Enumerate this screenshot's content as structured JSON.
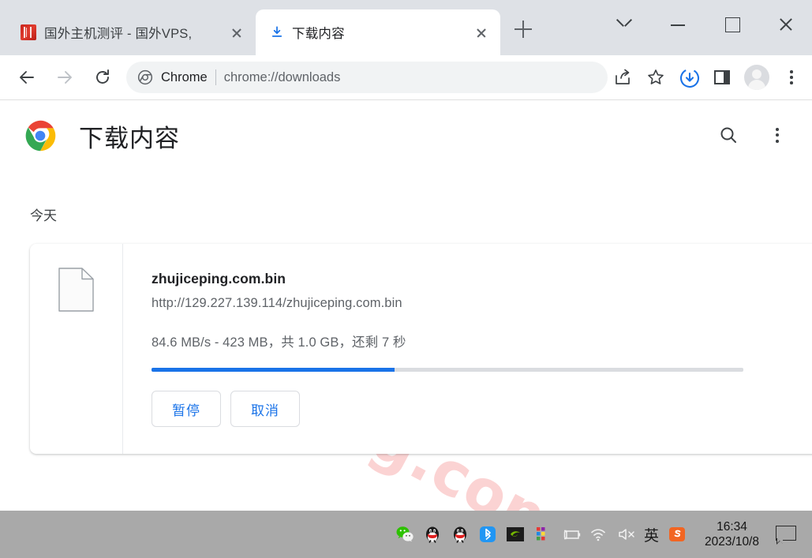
{
  "window": {
    "controls": {
      "tab_search": "tab-search",
      "minimize": "minimize",
      "maximize": "maximize",
      "close": "close"
    }
  },
  "tabs": [
    {
      "title": "国外主机测评 - 国外VPS,",
      "favicon": "seal-icon",
      "active": false
    },
    {
      "title": "下载内容",
      "favicon": "download-icon",
      "active": true
    }
  ],
  "new_tab_label": "+",
  "toolbar": {
    "back": "back-arrow",
    "forward": "forward-arrow",
    "reload": "reload",
    "omnibox": {
      "chrome_label": "Chrome",
      "url": "chrome://downloads"
    },
    "share": "share-icon",
    "bookmark": "star-icon",
    "downloads": "download-circle-icon",
    "side_panel": "side-panel-icon",
    "profile": "avatar",
    "menu": "three-dot-menu"
  },
  "page": {
    "title": "下载内容",
    "search_icon": "search-icon",
    "menu_icon": "three-dot-menu",
    "date_group": "今天",
    "watermark": "zhujiceping.com",
    "download": {
      "file_name": "zhujiceping.com.bin",
      "url": "http://129.227.139.114/zhujiceping.com.bin",
      "status": "84.6 MB/s - 423 MB，共 1.0 GB，还剩 7 秒",
      "progress_percent": 41,
      "pause_label": "暂停",
      "cancel_label": "取消"
    }
  },
  "taskbar": {
    "tray_icons": [
      "wechat-icon",
      "qq-icon",
      "qq-icon",
      "bluetooth-icon",
      "nvidia-icon",
      "windows-color-grid-icon",
      "battery-charging-icon",
      "wifi-icon",
      "volume-muted-icon"
    ],
    "ime_label": "英",
    "sogou_label": "S",
    "time": "16:34",
    "date": "2023/10/8",
    "notification_icon": "notification-icon"
  },
  "colors": {
    "accent_blue": "#1a73e8",
    "tabstrip_bg": "#dee1e6",
    "taskbar_bg": "#a9a9a9",
    "watermark_pink": "#f9b9b9"
  }
}
